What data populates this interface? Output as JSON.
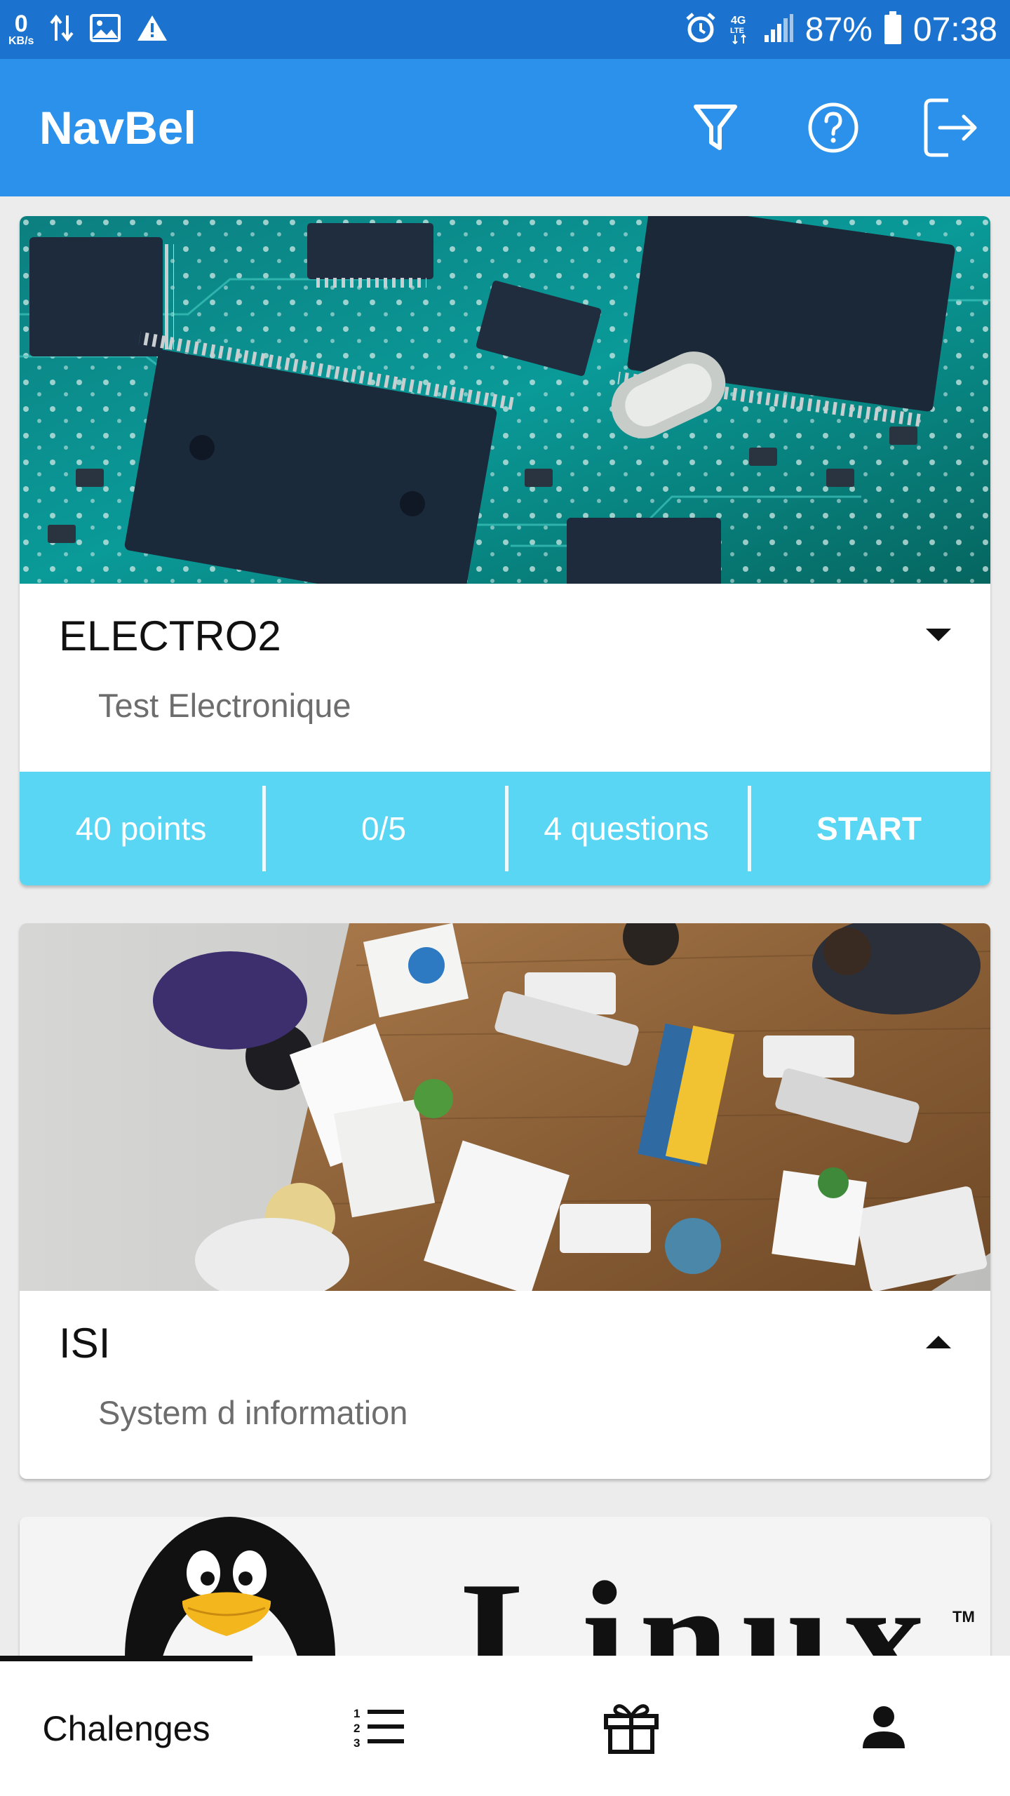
{
  "status_bar": {
    "speed_value": "0",
    "speed_unit": "KB/s",
    "battery": "87%",
    "time": "07:38",
    "icons": [
      "data-arrows-icon",
      "image-icon",
      "warning-icon",
      "alarm-icon",
      "4g-lte-icon",
      "signal-icon",
      "battery-icon"
    ]
  },
  "app_bar": {
    "title": "NavBel",
    "actions": [
      "filter-icon",
      "help-icon",
      "logout-icon"
    ],
    "color": "#2b91ea"
  },
  "cards": [
    {
      "title": "ELECTRO2",
      "description": "Test Electronique",
      "expanded": true,
      "image": "circuit-board-image",
      "stats": {
        "points": "40 points",
        "progress": "0/5",
        "questions": "4 questions",
        "action": "START"
      }
    },
    {
      "title": "ISI",
      "description": "System d information",
      "expanded": false,
      "image": "office-team-image"
    },
    {
      "title": "",
      "image": "linux-logo-image",
      "logo_text": "Linux"
    }
  ],
  "bottom_nav": {
    "items": [
      {
        "label": "Chalenges",
        "active": true
      },
      {
        "icon": "numbered-list-icon"
      },
      {
        "icon": "gift-icon"
      },
      {
        "icon": "person-icon"
      }
    ]
  },
  "colors": {
    "status_bar": "#1b73cf",
    "accent": "#5ad6f5"
  }
}
